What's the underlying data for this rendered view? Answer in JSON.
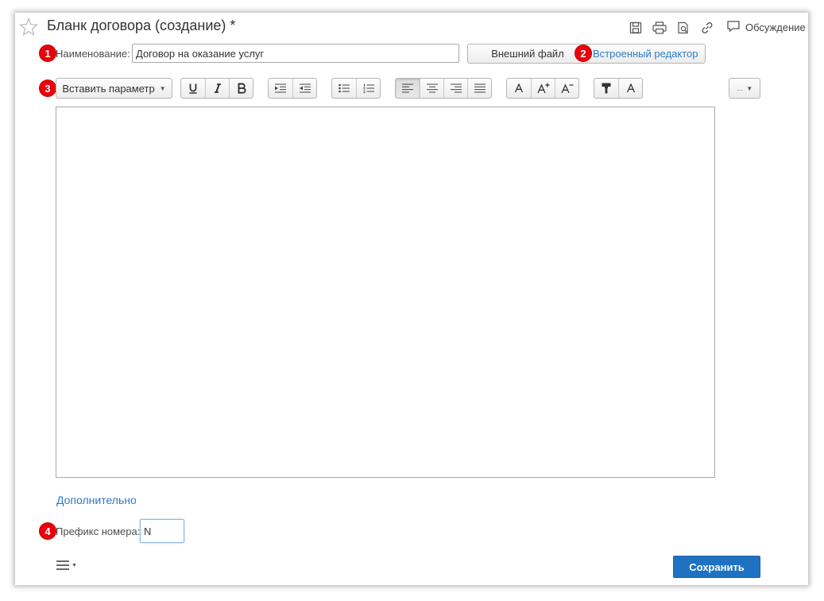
{
  "window": {
    "title": "Бланк договора (создание) *",
    "discussion_label": "Обсуждение",
    "icons": [
      "star-icon",
      "save-icon",
      "print-icon",
      "preview-icon",
      "link-icon",
      "chat-icon"
    ]
  },
  "badges": [
    "1",
    "2",
    "3",
    "4"
  ],
  "name_field": {
    "label": "Наименование:",
    "value": "Договор на оказание услуг"
  },
  "mode_buttons": {
    "external": "Внешний файл",
    "builtin": "Встроенный редактор"
  },
  "toolbar": {
    "insert_param": "Вставить параметр",
    "more": "..."
  },
  "additional_link": "Дополнительно",
  "prefix_field": {
    "label": "Префикс номера:",
    "value": "N"
  },
  "save_label": "Сохранить",
  "colors": {
    "accent": "#1f72c2",
    "link": "#2c7cc4",
    "badge": "#e8000b"
  }
}
